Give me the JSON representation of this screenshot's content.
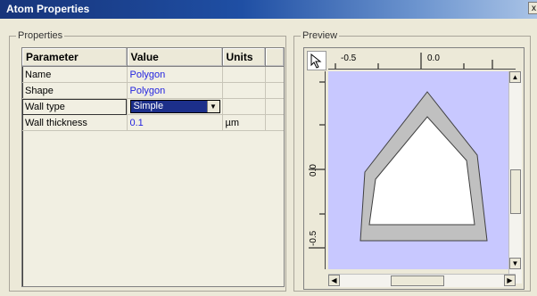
{
  "window": {
    "title": "Atom Properties",
    "close_glyph": "x"
  },
  "properties": {
    "group_label": "Properties",
    "columns": [
      "Parameter",
      "Value",
      "Units"
    ],
    "rows": [
      {
        "param": "Name",
        "value": "Polygon",
        "units": ""
      },
      {
        "param": "Shape",
        "value": "Polygon",
        "units": ""
      },
      {
        "param": "Wall type",
        "value": "Simple",
        "units": ""
      },
      {
        "param": "Wall thickness",
        "value": "0.1",
        "units": "µm"
      }
    ],
    "dropdown_arrow": "▼"
  },
  "preview": {
    "group_label": "Preview",
    "x_ticks": [
      "-0.5",
      "0.0"
    ],
    "y_ticks": [
      "0.0",
      "-0.5"
    ],
    "canvas_color": "#c8c8ff",
    "wall_color": "#c0c0c0"
  },
  "scroll": {
    "up": "▲",
    "down": "▼",
    "left": "◀",
    "right": "▶"
  }
}
